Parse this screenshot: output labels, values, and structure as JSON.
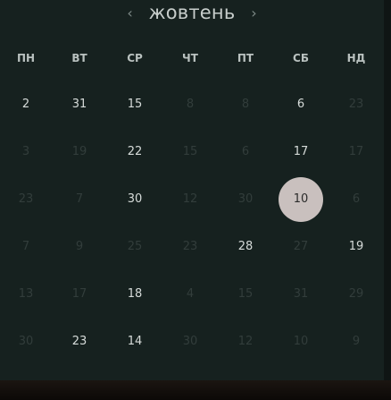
{
  "calendar": {
    "prev_icon": "‹",
    "next_icon": "›",
    "month_label": "жовтень",
    "weekdays": [
      "ПН",
      "ВТ",
      "СР",
      "ЧТ",
      "ПТ",
      "СБ",
      "НД"
    ],
    "days": [
      {
        "label": "2",
        "state": "active"
      },
      {
        "label": "31",
        "state": "active"
      },
      {
        "label": "15",
        "state": "active"
      },
      {
        "label": "8",
        "state": "dim"
      },
      {
        "label": "8",
        "state": "dim"
      },
      {
        "label": "6",
        "state": "active"
      },
      {
        "label": "23",
        "state": "dim"
      },
      {
        "label": "3",
        "state": "dim"
      },
      {
        "label": "19",
        "state": "dim"
      },
      {
        "label": "22",
        "state": "active"
      },
      {
        "label": "15",
        "state": "dim"
      },
      {
        "label": "6",
        "state": "dim"
      },
      {
        "label": "17",
        "state": "active"
      },
      {
        "label": "17",
        "state": "dim"
      },
      {
        "label": "23",
        "state": "dim"
      },
      {
        "label": "7",
        "state": "dim"
      },
      {
        "label": "30",
        "state": "active"
      },
      {
        "label": "12",
        "state": "dim"
      },
      {
        "label": "30",
        "state": "dim"
      },
      {
        "label": "10",
        "state": "selected"
      },
      {
        "label": "6",
        "state": "dim"
      },
      {
        "label": "7",
        "state": "dim"
      },
      {
        "label": "9",
        "state": "dim"
      },
      {
        "label": "25",
        "state": "dim"
      },
      {
        "label": "23",
        "state": "dim"
      },
      {
        "label": "28",
        "state": "active"
      },
      {
        "label": "27",
        "state": "dim"
      },
      {
        "label": "19",
        "state": "active"
      },
      {
        "label": "13",
        "state": "dim"
      },
      {
        "label": "17",
        "state": "dim"
      },
      {
        "label": "18",
        "state": "active"
      },
      {
        "label": "4",
        "state": "dim"
      },
      {
        "label": "15",
        "state": "dim"
      },
      {
        "label": "31",
        "state": "dim"
      },
      {
        "label": "29",
        "state": "dim"
      },
      {
        "label": "30",
        "state": "dim"
      },
      {
        "label": "23",
        "state": "active"
      },
      {
        "label": "14",
        "state": "active"
      },
      {
        "label": "30",
        "state": "dim"
      },
      {
        "label": "12",
        "state": "dim"
      },
      {
        "label": "10",
        "state": "dim"
      },
      {
        "label": "9",
        "state": "dim"
      }
    ]
  }
}
